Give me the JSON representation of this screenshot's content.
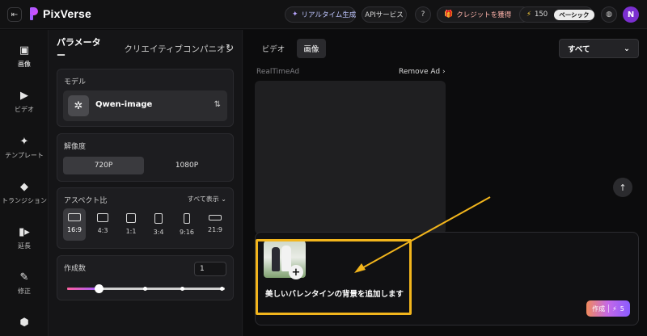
{
  "brand": {
    "name": "PixVerse",
    "accent": "#a25cff"
  },
  "topbar": {
    "realtime_label": "リアルタイム生成",
    "api_label": "APIサービス",
    "credit_label": "クレジットを獲得",
    "balance": "150",
    "plan_badge": "ベーシック",
    "avatar_initial": "N"
  },
  "nav": [
    {
      "label": "画像",
      "icon": "image-icon"
    },
    {
      "label": "ビデオ",
      "icon": "video-icon"
    },
    {
      "label": "テンプレート",
      "icon": "sparkle-icon"
    },
    {
      "label": "トランジション",
      "icon": "transition-icon"
    },
    {
      "label": "延長",
      "icon": "extend-icon"
    },
    {
      "label": "修正",
      "icon": "edit-icon"
    }
  ],
  "params": {
    "tab_active": "パラメーター",
    "tab_other": "クリエイティブコンパニオン",
    "model": {
      "title": "モデル",
      "name": "Qwen-image"
    },
    "resolution": {
      "title": "解像度",
      "options": [
        "720P",
        "1080P"
      ],
      "selected": "720P"
    },
    "aspect": {
      "title": "アスペクト比",
      "show_all": "すべて表示",
      "options": [
        "16:9",
        "4:3",
        "1:1",
        "3:4",
        "9:16",
        "21:9"
      ],
      "selected": "16:9"
    },
    "count": {
      "title": "作成数",
      "value": "1",
      "level": 0.2
    }
  },
  "main": {
    "tabs": [
      "ビデオ",
      "画像"
    ],
    "active_tab": "画像",
    "filter": "すべて",
    "ad_label": "RealTimeAd",
    "remove_ad": "Remove Ad",
    "prompt_text": "美しいバレンタインの背景を追加します",
    "create_label": "作成",
    "create_cost": "5"
  },
  "annotation_color": "#f2b51c"
}
